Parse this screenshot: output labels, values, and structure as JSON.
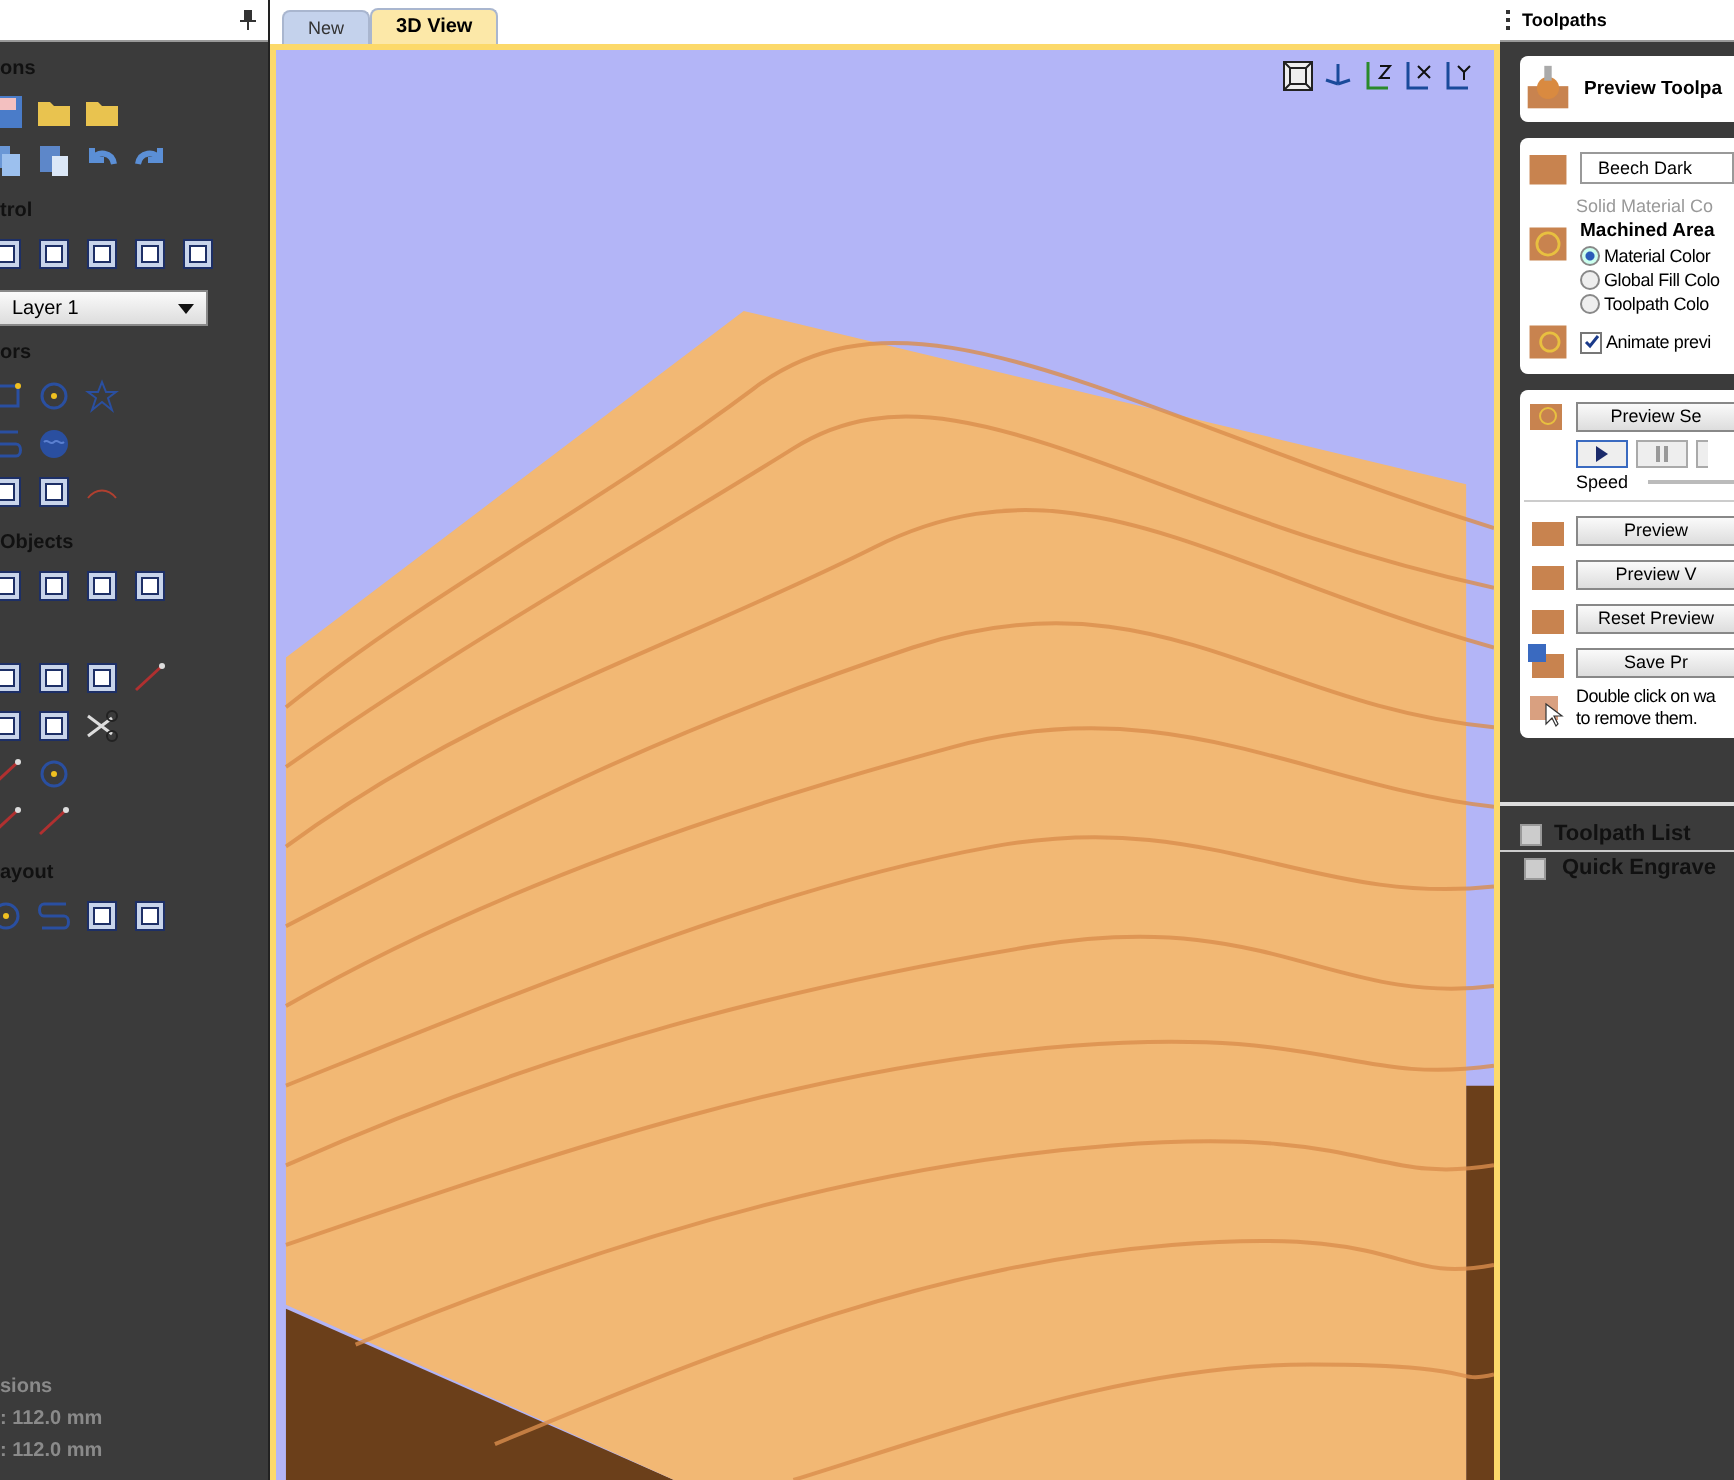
{
  "left_panel": {
    "sections": [
      {
        "title": "ons"
      },
      {
        "title": "trol",
        "layer_select": "Layer 1"
      },
      {
        "title": "ors"
      },
      {
        "title": "Objects"
      },
      {
        "title": "ayout"
      }
    ],
    "dimensions": {
      "title": "sions",
      "lines": [
        ": 112.0 mm",
        ": 112.0 mm"
      ]
    }
  },
  "tabs": [
    {
      "label": "New",
      "selected": false
    },
    {
      "label": "3D View",
      "selected": true
    }
  ],
  "right_panel": {
    "title": "Toolpaths",
    "header": "Preview Toolpa",
    "material": "Beech Dark",
    "material_hint": "Solid Material Co",
    "machined_title": "Machined Area",
    "options": [
      {
        "label": "Material Color",
        "selected": true
      },
      {
        "label": "Global Fill Colo",
        "selected": false
      },
      {
        "label": "Toolpath Colo",
        "selected": false
      }
    ],
    "animate": {
      "label": "Animate previ",
      "checked": true
    },
    "preview_selected": "Preview Se",
    "speed_label": "Speed",
    "buttons": [
      "Preview",
      "Preview V",
      "Reset Preview",
      "Save Pr"
    ],
    "hint": [
      "Double click on wa",
      "to remove them."
    ],
    "list_title": "Toolpath List",
    "list_checked": false,
    "toolpaths": [
      {
        "name": "Quick Engrave",
        "checked": false
      }
    ]
  }
}
